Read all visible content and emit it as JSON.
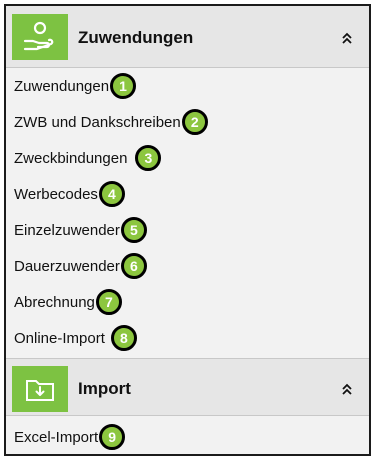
{
  "sections": [
    {
      "title": "Zuwendungen",
      "icon": "hand-money-icon",
      "items": [
        {
          "label": "Zuwendungen",
          "badge": "1"
        },
        {
          "label": "ZWB und Dankschreiben",
          "badge": "2"
        },
        {
          "label": "Zweckbindungen",
          "badge": "3"
        },
        {
          "label": "Werbecodes",
          "badge": "4"
        },
        {
          "label": "Einzelzuwender",
          "badge": "5"
        },
        {
          "label": "Dauerzuwender",
          "badge": "6"
        },
        {
          "label": "Abrechnung",
          "badge": "7"
        },
        {
          "label": "Online-Import",
          "badge": "8"
        }
      ]
    },
    {
      "title": "Import",
      "icon": "folder-import-icon",
      "items": [
        {
          "label": "Excel-Import",
          "badge": "9"
        }
      ]
    }
  ],
  "colors": {
    "accent_green": "#7dc242",
    "badge_green": "#8cc63f",
    "header_bg": "#e6e6e6",
    "panel_bg": "#f2f2f2"
  }
}
